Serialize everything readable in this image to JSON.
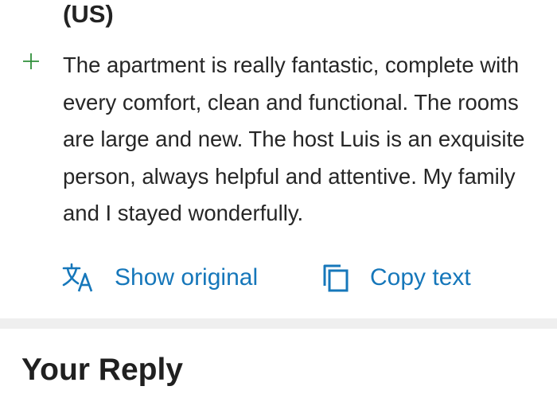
{
  "review": {
    "country": "(US)",
    "text": "The apartment is really fantastic, complete with every comfort, clean and functional. The rooms are large and new. The host Luis is an exquisite person, always helpful and attentive. My family and I stayed wonderfully.",
    "actions": {
      "show_original": "Show original",
      "copy_text": "Copy text"
    }
  },
  "reply": {
    "title": "Your Reply"
  },
  "colors": {
    "accent": "#1677ba",
    "positive": "#2f8f3a",
    "divider": "#efefef"
  },
  "icons": {
    "positive": "plus-icon",
    "translate": "translate-icon",
    "copy": "copy-icon"
  }
}
